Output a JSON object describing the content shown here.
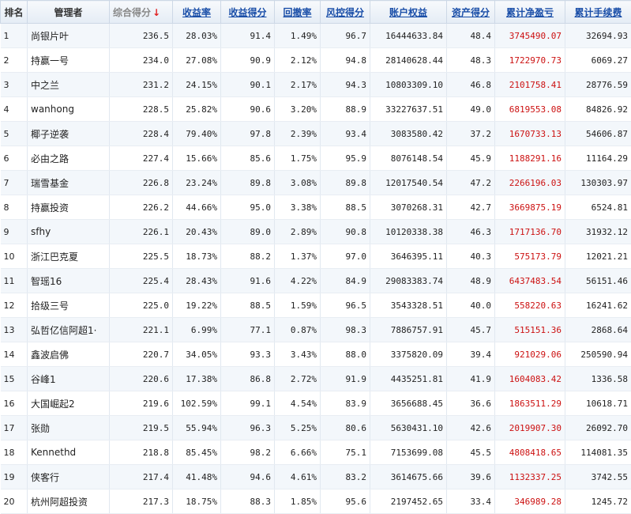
{
  "headers": {
    "rank": "排名",
    "manager": "管理者",
    "score": "综合得分",
    "sort_arrow": "↓",
    "return_rate": "收益率",
    "return_score": "收益得分",
    "drawdown": "回撤率",
    "risk_score": "风控得分",
    "equity": "账户权益",
    "asset_score": "资产得分",
    "net_pnl": "累计净盈亏",
    "fees": "累计手续费"
  },
  "rows": [
    {
      "rank": "1",
      "manager": "尚银片叶",
      "score": "236.5",
      "return_rate": "28.03%",
      "return_score": "91.4",
      "drawdown": "1.49%",
      "risk_score": "96.7",
      "equity": "16444633.84",
      "asset_score": "48.4",
      "net_pnl": "3745490.07",
      "fees": "32694.93"
    },
    {
      "rank": "2",
      "manager": "持赢一号",
      "score": "234.0",
      "return_rate": "27.08%",
      "return_score": "90.9",
      "drawdown": "2.12%",
      "risk_score": "94.8",
      "equity": "28140628.44",
      "asset_score": "48.3",
      "net_pnl": "1722970.73",
      "fees": "6069.27"
    },
    {
      "rank": "3",
      "manager": "中之兰",
      "score": "231.2",
      "return_rate": "24.15%",
      "return_score": "90.1",
      "drawdown": "2.17%",
      "risk_score": "94.3",
      "equity": "10803309.10",
      "asset_score": "46.8",
      "net_pnl": "2101758.41",
      "fees": "28776.59"
    },
    {
      "rank": "4",
      "manager": "wanhong",
      "score": "228.5",
      "return_rate": "25.82%",
      "return_score": "90.6",
      "drawdown": "3.20%",
      "risk_score": "88.9",
      "equity": "33227637.51",
      "asset_score": "49.0",
      "net_pnl": "6819553.08",
      "fees": "84826.92"
    },
    {
      "rank": "5",
      "manager": "椰子逆袭",
      "score": "228.4",
      "return_rate": "79.40%",
      "return_score": "97.8",
      "drawdown": "2.39%",
      "risk_score": "93.4",
      "equity": "3083580.42",
      "asset_score": "37.2",
      "net_pnl": "1670733.13",
      "fees": "54606.87"
    },
    {
      "rank": "6",
      "manager": "必由之路",
      "score": "227.4",
      "return_rate": "15.66%",
      "return_score": "85.6",
      "drawdown": "1.75%",
      "risk_score": "95.9",
      "equity": "8076148.54",
      "asset_score": "45.9",
      "net_pnl": "1188291.16",
      "fees": "11164.29"
    },
    {
      "rank": "7",
      "manager": "瑞雪基金",
      "score": "226.8",
      "return_rate": "23.24%",
      "return_score": "89.8",
      "drawdown": "3.08%",
      "risk_score": "89.8",
      "equity": "12017540.54",
      "asset_score": "47.2",
      "net_pnl": "2266196.03",
      "fees": "130303.97"
    },
    {
      "rank": "8",
      "manager": "持赢投资",
      "score": "226.2",
      "return_rate": "44.66%",
      "return_score": "95.0",
      "drawdown": "3.38%",
      "risk_score": "88.5",
      "equity": "3070268.31",
      "asset_score": "42.7",
      "net_pnl": "3669875.19",
      "fees": "6524.81"
    },
    {
      "rank": "9",
      "manager": "sfhy",
      "score": "226.1",
      "return_rate": "20.43%",
      "return_score": "89.0",
      "drawdown": "2.89%",
      "risk_score": "90.8",
      "equity": "10120338.38",
      "asset_score": "46.3",
      "net_pnl": "1717136.70",
      "fees": "31932.12"
    },
    {
      "rank": "10",
      "manager": "浙江巴克夏",
      "score": "225.5",
      "return_rate": "18.73%",
      "return_score": "88.2",
      "drawdown": "1.37%",
      "risk_score": "97.0",
      "equity": "3646395.11",
      "asset_score": "40.3",
      "net_pnl": "575173.79",
      "fees": "12021.21"
    },
    {
      "rank": "11",
      "manager": "智瑶16",
      "score": "225.4",
      "return_rate": "28.43%",
      "return_score": "91.6",
      "drawdown": "4.22%",
      "risk_score": "84.9",
      "equity": "29083383.74",
      "asset_score": "48.9",
      "net_pnl": "6437483.54",
      "fees": "56151.46"
    },
    {
      "rank": "12",
      "manager": "拾级三号",
      "score": "225.0",
      "return_rate": "19.22%",
      "return_score": "88.5",
      "drawdown": "1.59%",
      "risk_score": "96.5",
      "equity": "3543328.51",
      "asset_score": "40.0",
      "net_pnl": "558220.63",
      "fees": "16241.62"
    },
    {
      "rank": "13",
      "manager": "弘哲亿信阿超1·",
      "score": "221.1",
      "return_rate": "6.99%",
      "return_score": "77.1",
      "drawdown": "0.87%",
      "risk_score": "98.3",
      "equity": "7886757.91",
      "asset_score": "45.7",
      "net_pnl": "515151.36",
      "fees": "2868.64"
    },
    {
      "rank": "14",
      "manager": "鑫波启佛",
      "score": "220.7",
      "return_rate": "34.05%",
      "return_score": "93.3",
      "drawdown": "3.43%",
      "risk_score": "88.0",
      "equity": "3375820.09",
      "asset_score": "39.4",
      "net_pnl": "921029.06",
      "fees": "250590.94"
    },
    {
      "rank": "15",
      "manager": "谷峰1",
      "score": "220.6",
      "return_rate": "17.38%",
      "return_score": "86.8",
      "drawdown": "2.72%",
      "risk_score": "91.9",
      "equity": "4435251.81",
      "asset_score": "41.9",
      "net_pnl": "1604083.42",
      "fees": "1336.58"
    },
    {
      "rank": "16",
      "manager": "大国崛起2",
      "score": "219.6",
      "return_rate": "102.59%",
      "return_score": "99.1",
      "drawdown": "4.54%",
      "risk_score": "83.9",
      "equity": "3656688.45",
      "asset_score": "36.6",
      "net_pnl": "1863511.29",
      "fees": "10618.71"
    },
    {
      "rank": "17",
      "manager": "张勋",
      "score": "219.5",
      "return_rate": "55.94%",
      "return_score": "96.3",
      "drawdown": "5.25%",
      "risk_score": "80.6",
      "equity": "5630431.10",
      "asset_score": "42.6",
      "net_pnl": "2019907.30",
      "fees": "26092.70"
    },
    {
      "rank": "18",
      "manager": "Kennethd",
      "score": "218.8",
      "return_rate": "85.45%",
      "return_score": "98.2",
      "drawdown": "6.66%",
      "risk_score": "75.1",
      "equity": "7153699.08",
      "asset_score": "45.5",
      "net_pnl": "4808418.65",
      "fees": "114081.35"
    },
    {
      "rank": "19",
      "manager": "侠客行",
      "score": "217.4",
      "return_rate": "41.48%",
      "return_score": "94.6",
      "drawdown": "4.61%",
      "risk_score": "83.2",
      "equity": "3614675.66",
      "asset_score": "39.6",
      "net_pnl": "1132337.25",
      "fees": "3742.55"
    },
    {
      "rank": "20",
      "manager": "杭州阿超投资",
      "score": "217.3",
      "return_rate": "18.75%",
      "return_score": "88.3",
      "drawdown": "1.85%",
      "risk_score": "95.6",
      "equity": "2197452.65",
      "asset_score": "33.4",
      "net_pnl": "346989.28",
      "fees": "1245.72"
    }
  ],
  "colors": {
    "header_link": "#1a4ea8",
    "net_pnl": "#cc1111",
    "sort_arrow": "#e02020",
    "row_stripe": "#f3f7fb"
  }
}
